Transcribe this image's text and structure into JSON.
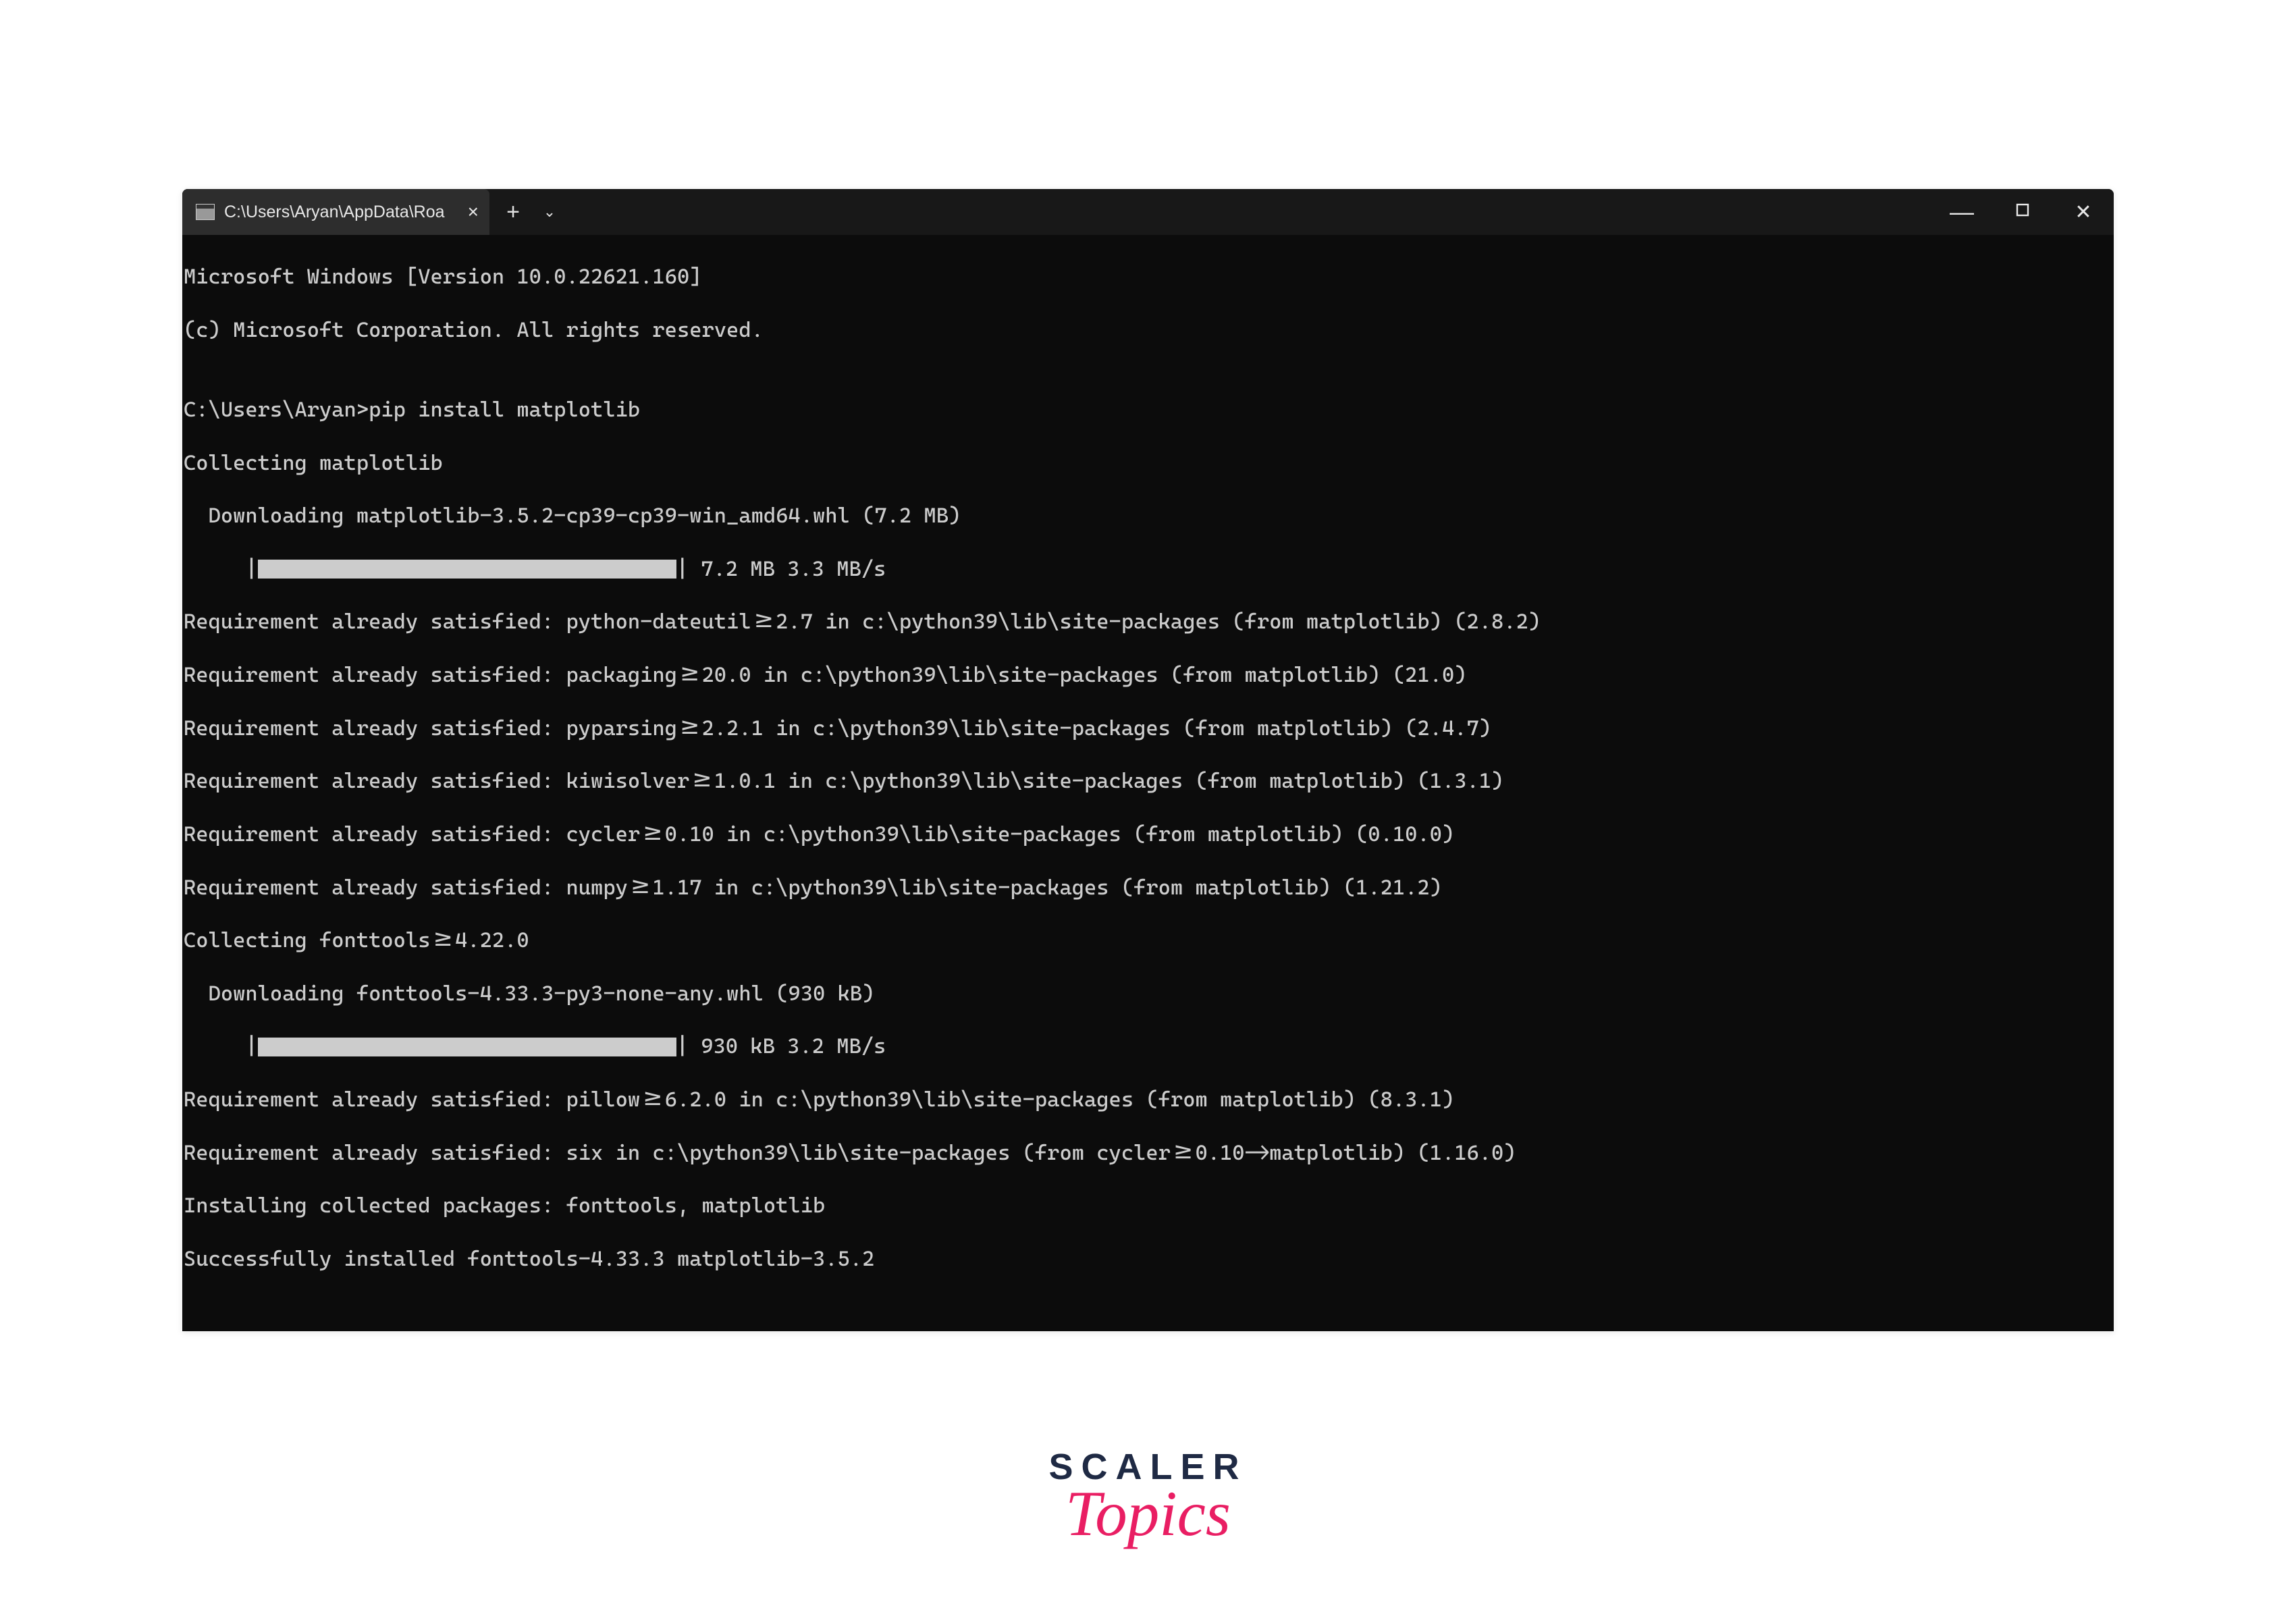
{
  "titlebar": {
    "tab_title": "C:\\Users\\Aryan\\AppData\\Roa",
    "new_tab_label": "+",
    "chevron_label": "⌄",
    "minimize_label": "—",
    "close_label": "✕"
  },
  "terminal": {
    "line1": "Microsoft Windows [Version 10.0.22621.160]",
    "line2": "(c) Microsoft Corporation. All rights reserved.",
    "blank1": "",
    "prompt": "C:\\Users\\Aryan>pip install matplotlib",
    "coll1": "Collecting matplotlib",
    "dl1": "  Downloading matplotlib-3.5.2-cp39-cp39-win_amd64.whl (7.2 MB)",
    "bar1_prefix": "     |",
    "bar1_suffix": "| 7.2 MB 3.3 MB/s",
    "req1": "Requirement already satisfied: python-dateutil>=2.7 in c:\\python39\\lib\\site-packages (from matplotlib) (2.8.2)",
    "req2": "Requirement already satisfied: packaging>=20.0 in c:\\python39\\lib\\site-packages (from matplotlib) (21.0)",
    "req3": "Requirement already satisfied: pyparsing>=2.2.1 in c:\\python39\\lib\\site-packages (from matplotlib) (2.4.7)",
    "req4": "Requirement already satisfied: kiwisolver>=1.0.1 in c:\\python39\\lib\\site-packages (from matplotlib) (1.3.1)",
    "req5": "Requirement already satisfied: cycler>=0.10 in c:\\python39\\lib\\site-packages (from matplotlib) (0.10.0)",
    "req6": "Requirement already satisfied: numpy>=1.17 in c:\\python39\\lib\\site-packages (from matplotlib) (1.21.2)",
    "coll2": "Collecting fonttools>=4.22.0",
    "dl2": "  Downloading fonttools-4.33.3-py3-none-any.whl (930 kB)",
    "bar2_prefix": "     |",
    "bar2_suffix": "| 930 kB 3.2 MB/s",
    "req7": "Requirement already satisfied: pillow>=6.2.0 in c:\\python39\\lib\\site-packages (from matplotlib) (8.3.1)",
    "req8": "Requirement already satisfied: six in c:\\python39\\lib\\site-packages (from cycler>=0.10->matplotlib) (1.16.0)",
    "install": "Installing collected packages: fonttools, matplotlib",
    "success": "Successfully installed fonttools-4.33.3 matplotlib-3.5.2"
  },
  "logo": {
    "top": "SCALER",
    "bottom": "Topics"
  }
}
